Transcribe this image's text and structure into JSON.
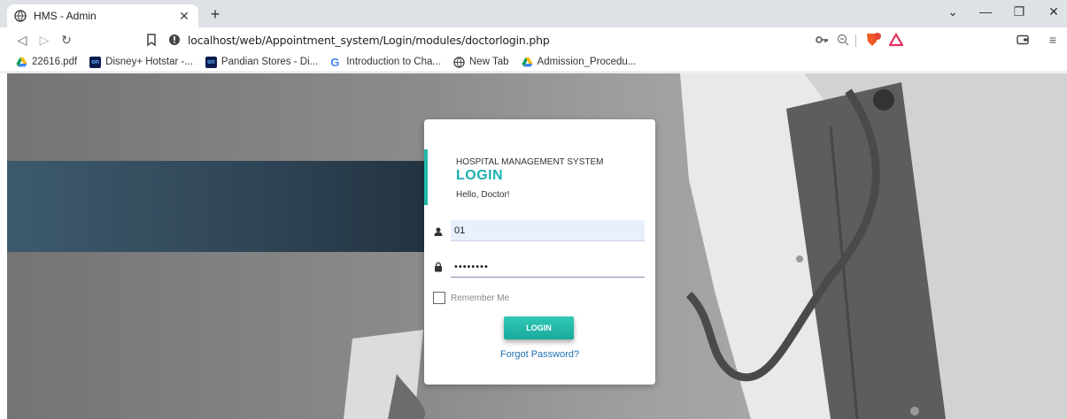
{
  "browser": {
    "tab_title": "HMS - Admin",
    "url": "localhost/web/Appointment_system/Login/modules/doctorlogin.php",
    "bookmarks": [
      {
        "label": "22616.pdf",
        "icon": "drive-icon"
      },
      {
        "label": "Disney+ Hotstar -...",
        "icon": "hotstar-icon"
      },
      {
        "label": "Pandian Stores - Di...",
        "icon": "hotstar-icon"
      },
      {
        "label": "Introduction to Cha...",
        "icon": "google-icon"
      },
      {
        "label": "New Tab",
        "icon": "globe-icon"
      },
      {
        "label": "Admission_Procedu...",
        "icon": "drive-icon"
      }
    ]
  },
  "login": {
    "system_name": "HOSPITAL MANAGEMENT SYSTEM",
    "heading": "LOGIN",
    "greeting": "Hello, Doctor!",
    "username_value": "01",
    "password_value": "••••••••",
    "remember_label": "Remember Me",
    "button_label": "LOGIN",
    "forgot_label": "Forgot Password?"
  },
  "colors": {
    "accent": "#1db0b0",
    "link": "#1f6fb2"
  }
}
